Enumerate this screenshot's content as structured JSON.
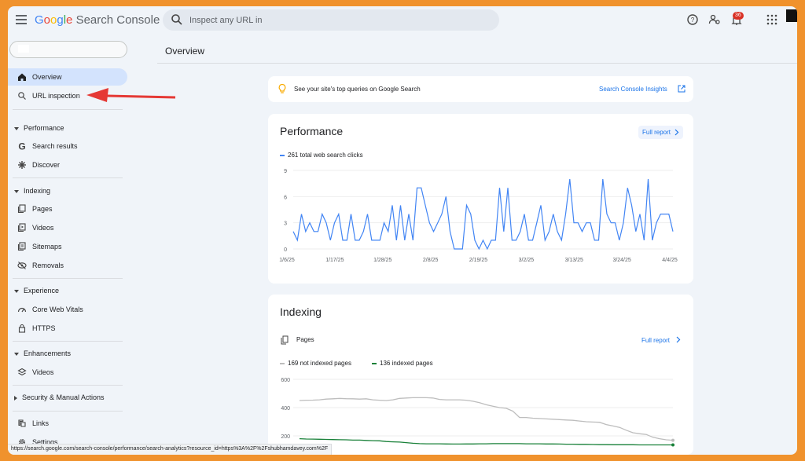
{
  "topbar": {
    "logo_google": [
      "G",
      "o",
      "o",
      "g",
      "l",
      "e"
    ],
    "logo_product": "Search Console",
    "search_placeholder": "Inspect any URL in",
    "notification_count": "36"
  },
  "sidebar": {
    "items": [
      {
        "label": "Overview",
        "icon": "home-icon",
        "active": true
      },
      {
        "label": "URL inspection",
        "icon": "search-icon",
        "active": false
      }
    ],
    "sections": [
      {
        "label": "Performance",
        "expanded": true,
        "items": [
          {
            "label": "Search results",
            "icon": "google-g-icon"
          },
          {
            "label": "Discover",
            "icon": "asterisk-icon"
          }
        ]
      },
      {
        "label": "Indexing",
        "expanded": true,
        "items": [
          {
            "label": "Pages",
            "icon": "pages-icon"
          },
          {
            "label": "Videos",
            "icon": "video-icon"
          },
          {
            "label": "Sitemaps",
            "icon": "sitemap-icon"
          },
          {
            "label": "Removals",
            "icon": "visibility-off-icon"
          }
        ]
      },
      {
        "label": "Experience",
        "expanded": true,
        "items": [
          {
            "label": "Core Web Vitals",
            "icon": "speed-icon"
          },
          {
            "label": "HTTPS",
            "icon": "lock-icon"
          }
        ]
      },
      {
        "label": "Enhancements",
        "expanded": true,
        "items": [
          {
            "label": "Videos",
            "icon": "layers-icon"
          }
        ]
      },
      {
        "label": "Security & Manual Actions",
        "expanded": false,
        "items": []
      }
    ],
    "bottom_items": [
      {
        "label": "Links",
        "icon": "link-icon"
      },
      {
        "label": "Settings",
        "icon": "gear-icon"
      }
    ]
  },
  "main": {
    "page_title": "Overview",
    "insight": {
      "text": "See your site's top queries on Google Search",
      "link": "Search Console Insights"
    },
    "performance": {
      "title": "Performance",
      "full_report": "Full report",
      "legend": "261 total web search clicks",
      "color": "#4285f4"
    },
    "indexing": {
      "title": "Indexing",
      "pages_label": "Pages",
      "full_report": "Full report",
      "legend_not_indexed": "169 not indexed pages",
      "legend_indexed": "136 indexed pages",
      "color_not_indexed": "#bdbdbd",
      "color_indexed": "#188038"
    }
  },
  "status_url": "https://search.google.com/search-console/performance/search-analytics?resource_id=https%3A%2F%2Fshubhamdavey.com%2F",
  "chart_data": [
    {
      "type": "line",
      "title": "Performance",
      "series": [
        {
          "name": "261 total web search clicks",
          "values": [
            2,
            1,
            4,
            2,
            3,
            2,
            2,
            4,
            3,
            1,
            3,
            4,
            1,
            1,
            4,
            1,
            1,
            2,
            4,
            1,
            1,
            1,
            3,
            2,
            5,
            1,
            5,
            1,
            4,
            1,
            7,
            7,
            5,
            3,
            2,
            3,
            4,
            6,
            2,
            0,
            0,
            0,
            5,
            4,
            1,
            0,
            1,
            0,
            1,
            1,
            7,
            2,
            7,
            1,
            1,
            2,
            4,
            1,
            1,
            3,
            5,
            1,
            2,
            4,
            2,
            1,
            4,
            8,
            3,
            3,
            2,
            3,
            3,
            1,
            1,
            8,
            4,
            3,
            3,
            1,
            3,
            7,
            5,
            2,
            4,
            1,
            8,
            1,
            3,
            4,
            4,
            4,
            2
          ]
        }
      ],
      "x_ticks": [
        "1/6/25",
        "1/17/25",
        "1/28/25",
        "2/8/25",
        "2/19/25",
        "3/2/25",
        "3/13/25",
        "3/24/25",
        "4/4/25"
      ],
      "y_ticks": [
        0,
        3,
        6,
        9
      ],
      "ylim": [
        0,
        9
      ],
      "grid": true
    },
    {
      "type": "line",
      "title": "Indexing",
      "series": [
        {
          "name": "169 not indexed pages",
          "values": [
            450,
            452,
            453,
            455,
            460,
            462,
            465,
            463,
            462,
            460,
            462,
            455,
            452,
            450,
            455,
            465,
            468,
            470,
            470,
            470,
            468,
            458,
            455,
            455,
            455,
            452,
            445,
            435,
            420,
            410,
            400,
            395,
            375,
            330,
            330,
            325,
            323,
            320,
            318,
            315,
            312,
            310,
            305,
            300,
            298,
            296,
            280,
            270,
            260,
            240,
            222,
            215,
            210,
            190,
            180,
            172,
            169
          ]
        },
        {
          "name": "136 indexed pages",
          "values": [
            180,
            178,
            177,
            176,
            175,
            174,
            173,
            172,
            170,
            170,
            168,
            166,
            165,
            160,
            158,
            156,
            152,
            148,
            145,
            144,
            144,
            144,
            143,
            142,
            142,
            143,
            143,
            144,
            144,
            145,
            145,
            145,
            145,
            145,
            144,
            144,
            144,
            143,
            143,
            142,
            141,
            141,
            140,
            140,
            139,
            138,
            138,
            137,
            137,
            137,
            137,
            136,
            136,
            136,
            136,
            136,
            136
          ]
        }
      ],
      "y_ticks": [
        200,
        400,
        600
      ],
      "ylim": [
        100,
        600
      ],
      "grid": true
    }
  ]
}
